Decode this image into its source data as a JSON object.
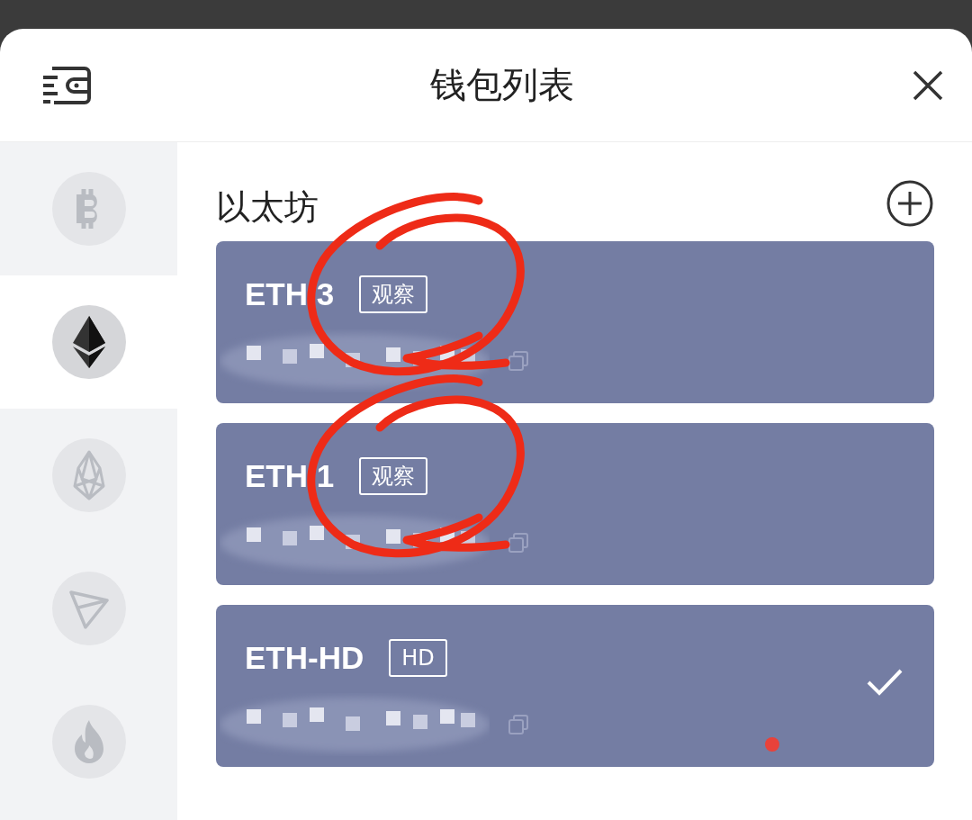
{
  "header": {
    "title": "钱包列表"
  },
  "chains": [
    {
      "kind": "bitcoin",
      "selected": false
    },
    {
      "kind": "ethereum",
      "selected": true
    },
    {
      "kind": "eos",
      "selected": false
    },
    {
      "kind": "tron",
      "selected": false
    },
    {
      "kind": "flame",
      "selected": false
    }
  ],
  "section": {
    "title": "以太坊"
  },
  "wallets": [
    {
      "name": "ETH 3",
      "tag": "观察",
      "selected": false,
      "circled": true
    },
    {
      "name": "ETH 1",
      "tag": "观察",
      "selected": false,
      "circled": true
    },
    {
      "name": "ETH-HD",
      "tag": "HD",
      "selected": true,
      "circled": false,
      "dot": true
    }
  ]
}
